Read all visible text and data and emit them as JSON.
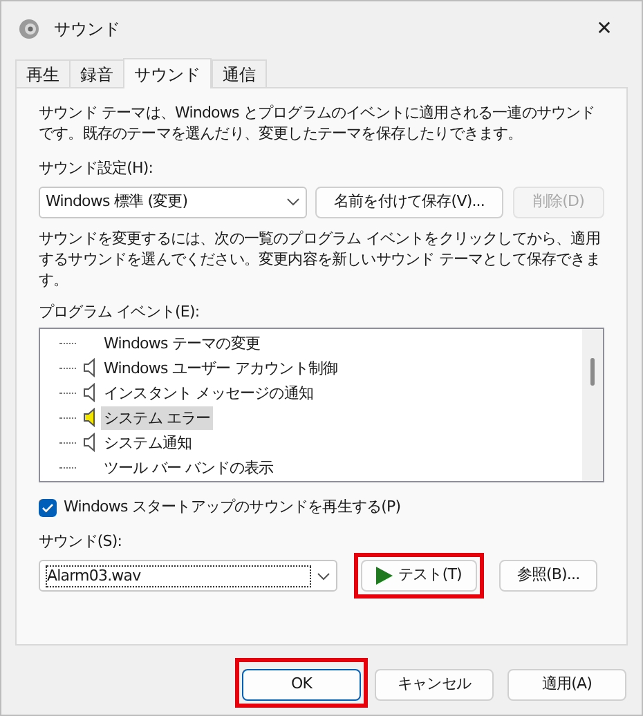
{
  "window": {
    "title": "サウンド",
    "close": "✕"
  },
  "tabs": [
    {
      "label": "再生",
      "selected": false
    },
    {
      "label": "録音",
      "selected": false
    },
    {
      "label": "サウンド",
      "selected": true
    },
    {
      "label": "通信",
      "selected": false
    }
  ],
  "intro": "サウンド テーマは、Windows とプログラムのイベントに適用される一連のサウンドです。既存のテーマを選んだり、変更したテーマを保存したりできます。",
  "scheme": {
    "label": "サウンド設定(H):",
    "value": "Windows 標準 (変更)",
    "save_button": {
      "label": "名前を付けて保存(V)...",
      "disabled": false
    },
    "delete_button": {
      "label": "削除(D)",
      "disabled": true
    }
  },
  "instructions": "サウンドを変更するには、次の一覧のプログラム イベントをクリックしてから、適用するサウンドを選んでください。変更内容を新しいサウンド テーマとして保存できます。",
  "events": {
    "label": "プログラム イベント(E):",
    "items": [
      {
        "label": "Windows テーマの変更",
        "kind": "silent",
        "selected": false
      },
      {
        "label": "Windows ユーザー アカウント制御",
        "kind": "sound",
        "selected": false
      },
      {
        "label": "インスタント メッセージの通知",
        "kind": "sound",
        "selected": false
      },
      {
        "label": "システム エラー",
        "kind": "sound",
        "selected": true
      },
      {
        "label": "システム通知",
        "kind": "sound",
        "selected": false
      },
      {
        "label": "ツール バー バンドの表示",
        "kind": "silent",
        "selected": false
      }
    ]
  },
  "startup": {
    "label": "Windows スタートアップのサウンドを再生する(P)",
    "checked": true
  },
  "sound": {
    "label": "サウンド(S):",
    "value": "Alarm03.wav",
    "test_button": {
      "label": "テスト(T)",
      "highlighted": true
    },
    "browse_button": {
      "label": "参照(B)...",
      "highlighted": false
    }
  },
  "buttons": [
    {
      "label": "OK",
      "highlighted": true
    },
    {
      "label": "キャンセル",
      "highlighted": false
    },
    {
      "label": "適用(A)",
      "highlighted": false
    }
  ]
}
